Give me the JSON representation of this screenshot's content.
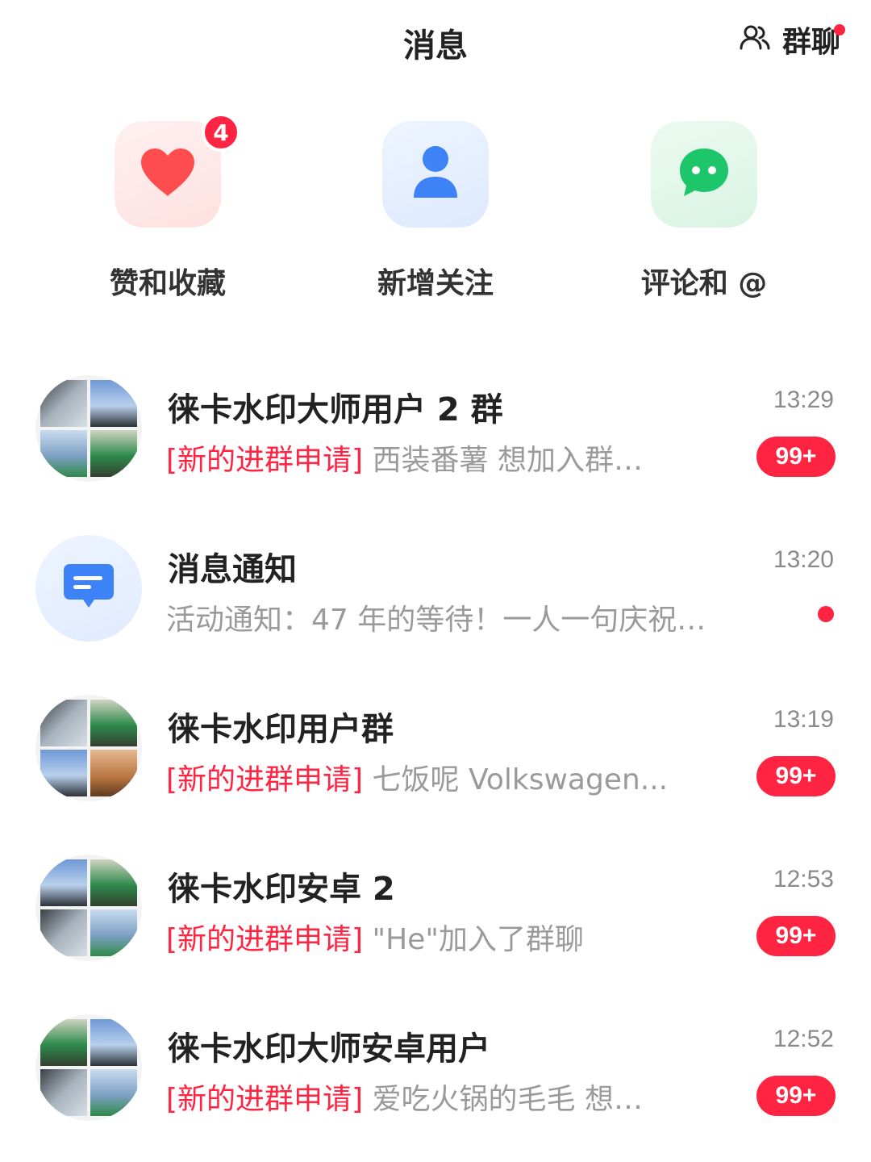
{
  "header": {
    "title": "消息",
    "group_chat_label": "群聊",
    "group_chat_icon": "group-people-icon"
  },
  "shortcuts": [
    {
      "label": "赞和收藏",
      "icon": "heart-icon",
      "badge": "4",
      "color": "#ff4d4f"
    },
    {
      "label": "新增关注",
      "icon": "person-icon",
      "color": "#3d82f6"
    },
    {
      "label": "评论和 @",
      "icon": "chat-bubble-icon",
      "color": "#1ec66b"
    }
  ],
  "conversations": [
    {
      "name": "徕卡水印大师用户 2 群",
      "time": "13:29",
      "tag": "[新的进群申请]",
      "preview": "西装番薯 想加入群…",
      "unread": "99+"
    },
    {
      "name": "消息通知",
      "time": "13:20",
      "preview": "活动通知：47 年的等待！一人一句庆祝…",
      "icon": "message-notice-icon"
    },
    {
      "name": "徕卡水印用户群",
      "time": "13:19",
      "tag": "[新的进群申请]",
      "preview": "七饭呢 Volkswagen...",
      "unread": "99+"
    },
    {
      "name": "徕卡水印安卓 2",
      "time": "12:53",
      "tag": "[新的进群申请]",
      "preview": "\"He\"加入了群聊",
      "unread": "99+"
    },
    {
      "name": "徕卡水印大师安卓用户",
      "time": "12:52",
      "tag": "[新的进群申请]",
      "preview": "爱吃火锅的毛毛 想…",
      "unread": "99+"
    }
  ],
  "colors": {
    "accent": "#ff2442",
    "text_primary": "#222222",
    "text_secondary": "#9a9a9a"
  }
}
